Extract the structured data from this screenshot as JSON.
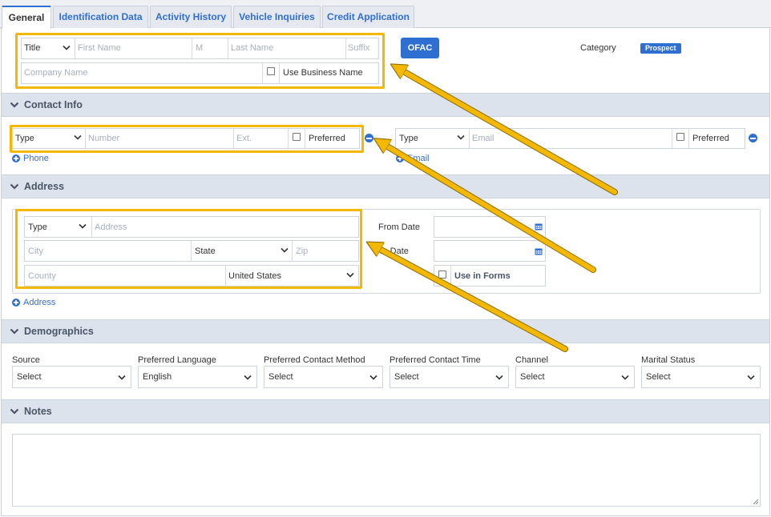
{
  "tabs": [
    "General",
    "Identification Data",
    "Activity History",
    "Vehicle Inquiries",
    "Credit Application"
  ],
  "name": {
    "title_value": "Title",
    "first_name_placeholder": "First Name",
    "middle_placeholder": "M",
    "last_name_placeholder": "Last Name",
    "suffix_placeholder": "Suffix",
    "company_placeholder": "Company Name",
    "use_business_label": "Use Business Name",
    "ofac_label": "OFAC",
    "category_label": "Category",
    "category_badge": "Prospect"
  },
  "contact": {
    "section_title": "Contact Info",
    "phone_type_value": "Type",
    "phone_number_placeholder": "Number",
    "phone_ext_placeholder": "Ext.",
    "phone_preferred_label": "Preferred",
    "add_phone_label": "Phone",
    "email_type_value": "Type",
    "email_placeholder": "Email",
    "email_preferred_label": "Preferred",
    "add_email_label": "Email"
  },
  "address": {
    "section_title": "Address",
    "type_value": "Type",
    "address_placeholder": "Address",
    "city_placeholder": "City",
    "state_value": "State",
    "zip_placeholder": "Zip",
    "county_placeholder": "County",
    "country_value": "United States",
    "from_date_label": "From Date",
    "to_date_label": "To Date",
    "use_in_forms_label": "Use in Forms",
    "add_address_label": "Address"
  },
  "demographics": {
    "section_title": "Demographics",
    "fields": [
      {
        "label": "Source",
        "value": "Select"
      },
      {
        "label": "Preferred Language",
        "value": "English"
      },
      {
        "label": "Preferred Contact Method",
        "value": "Select"
      },
      {
        "label": "Preferred Contact Time",
        "value": "Select"
      },
      {
        "label": "Channel",
        "value": "Select"
      },
      {
        "label": "Marital Status",
        "value": "Select"
      }
    ]
  },
  "notes": {
    "section_title": "Notes",
    "value": ""
  },
  "colors": {
    "accent": "#2f6fd1",
    "highlight": "#f5b800",
    "section_bg": "#dde3ec"
  },
  "icons": [
    "chevron-down-icon",
    "plus-circle-icon",
    "minus-circle-icon",
    "calendar-icon",
    "dropdown-caret-icon",
    "annotation-arrow"
  ]
}
